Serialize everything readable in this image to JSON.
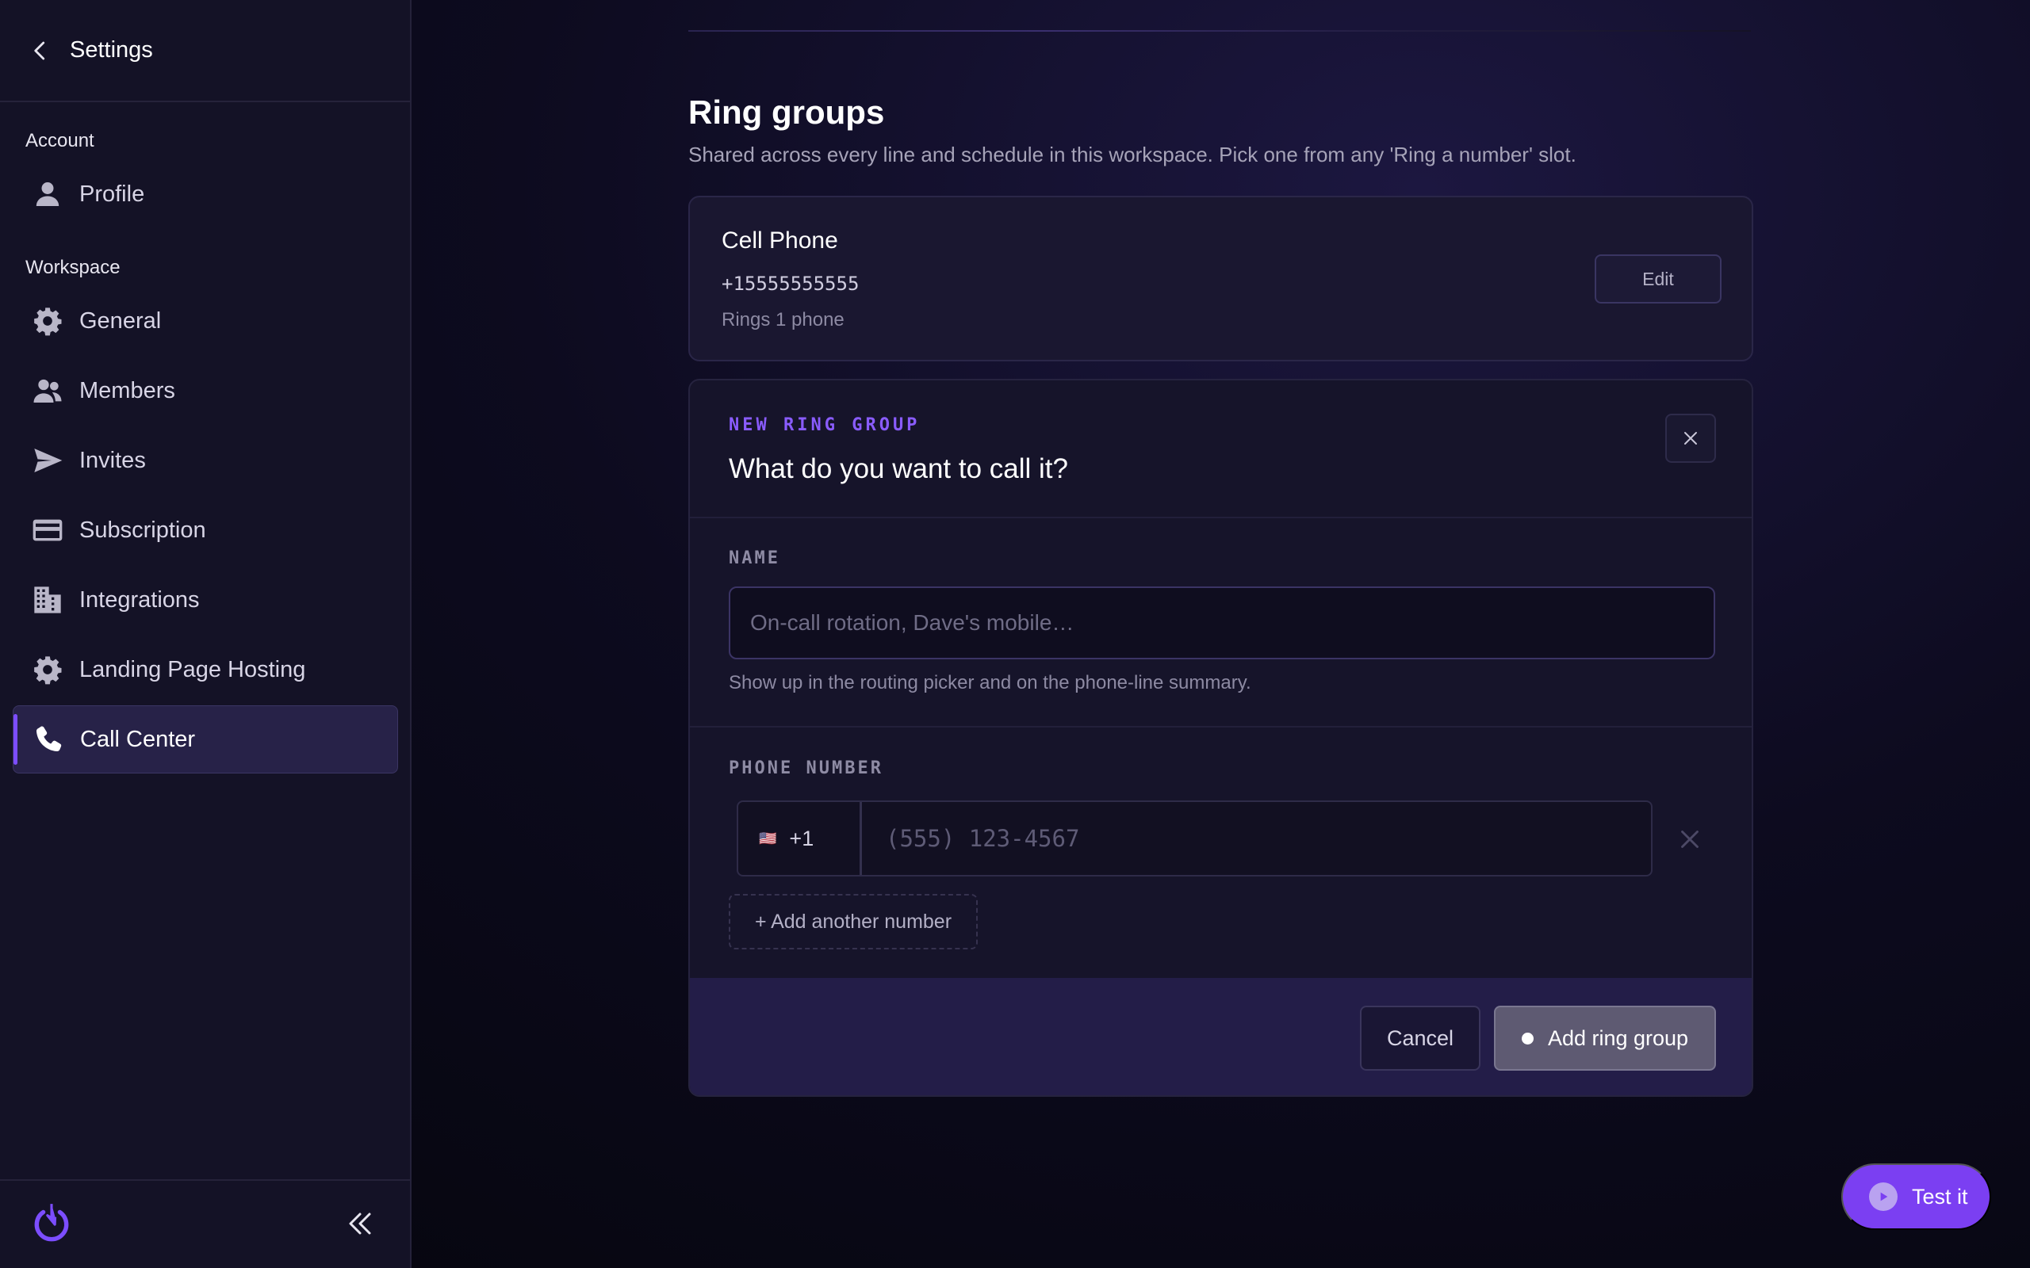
{
  "sidebar": {
    "title": "Settings",
    "sections": {
      "account": "Account",
      "workspace": "Workspace"
    },
    "items": [
      {
        "label": "Profile"
      },
      {
        "label": "General"
      },
      {
        "label": "Members"
      },
      {
        "label": "Invites"
      },
      {
        "label": "Subscription"
      },
      {
        "label": "Integrations"
      },
      {
        "label": "Landing Page Hosting"
      },
      {
        "label": "Call Center",
        "active": true
      }
    ]
  },
  "main": {
    "title": "Ring groups",
    "subtitle": "Shared across every line and schedule in this workspace. Pick one from any 'Ring a number' slot.",
    "existing_group": {
      "name": "Cell Phone",
      "number": "+15555555555",
      "rings": "Rings 1 phone",
      "edit_label": "Edit"
    },
    "new_group": {
      "eyebrow": "NEW RING GROUP",
      "question": "What do you want to call it?",
      "name_label": "NAME",
      "name_placeholder": "On-call rotation, Dave's mobile…",
      "name_value": "",
      "name_helper": "Show up in the routing picker and on the phone-line summary.",
      "phone_label": "PHONE NUMBER",
      "country_flag": "🇺🇸",
      "country_code": "+1",
      "phone_placeholder": "(555) 123-4567",
      "phone_value": "",
      "add_number_label": "+ Add another number",
      "cancel_label": "Cancel",
      "submit_label": "Add ring group"
    }
  },
  "test_button": {
    "label": "Test it"
  },
  "colors": {
    "accent": "#7b3ff2",
    "sidebar_bg": "#141226",
    "active_item_bg": "#272248"
  }
}
